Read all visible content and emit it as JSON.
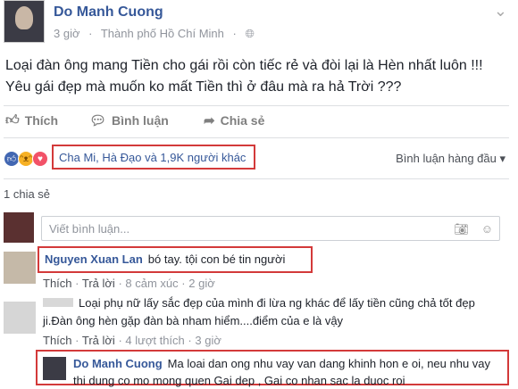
{
  "post": {
    "author": "Do Manh Cuong",
    "time": "3 giờ",
    "separator": "·",
    "location": "Thành phố Hồ Chí Minh",
    "audience_icon": "globe-icon",
    "line1": "Loại đàn ông mang Tiền cho gái rồi còn tiếc rẻ và đòi lại là Hèn nhất luôn !!!",
    "line2": "Yêu gái đẹp mà muốn ko mất Tiền thì ở đâu mà ra hả Trời ???"
  },
  "actions": {
    "like": "Thích",
    "comment": "Bình luận",
    "share": "Chia sẻ"
  },
  "reactions": {
    "summary": "Cha Mi, Hà Đạo và 1,9K người khác",
    "sort_label": "Bình luận hàng đầu ▾",
    "shares": "1 chia sẻ"
  },
  "comment_input": {
    "placeholder": "Viết bình luận..."
  },
  "comments": [
    {
      "name": "Nguyen Xuan Lan",
      "text": "bó tay. tội con bé tin người",
      "like": "Thích",
      "reply": "Trả lời",
      "reactions": "8 cảm xúc",
      "time": "2 giờ",
      "dot": "·"
    },
    {
      "text": "Loại phụ nữ lấy sắc đẹp của mình đi lừa ng khác để lấy tiền cũng chả tốt đẹp ji.Đàn ông hèn gặp đàn bà nham hiểm....điểm của e là vậy",
      "like": "Thích",
      "reply": "Trả lời",
      "reactions": "4 lượt thích",
      "time": "3 giờ",
      "dot": "·"
    }
  ],
  "reply": {
    "name": "Do Manh Cuong",
    "text": "Ma loai dan ong nhu vay van dang khinh hon e oi, neu nhu vay thi dung co mo mong quen Gai dep , Gai co nhan sac la duoc roi"
  },
  "colors": {
    "link": "#365899",
    "highlight_border": "#d33a3a",
    "like_blue": "#4267b2"
  }
}
